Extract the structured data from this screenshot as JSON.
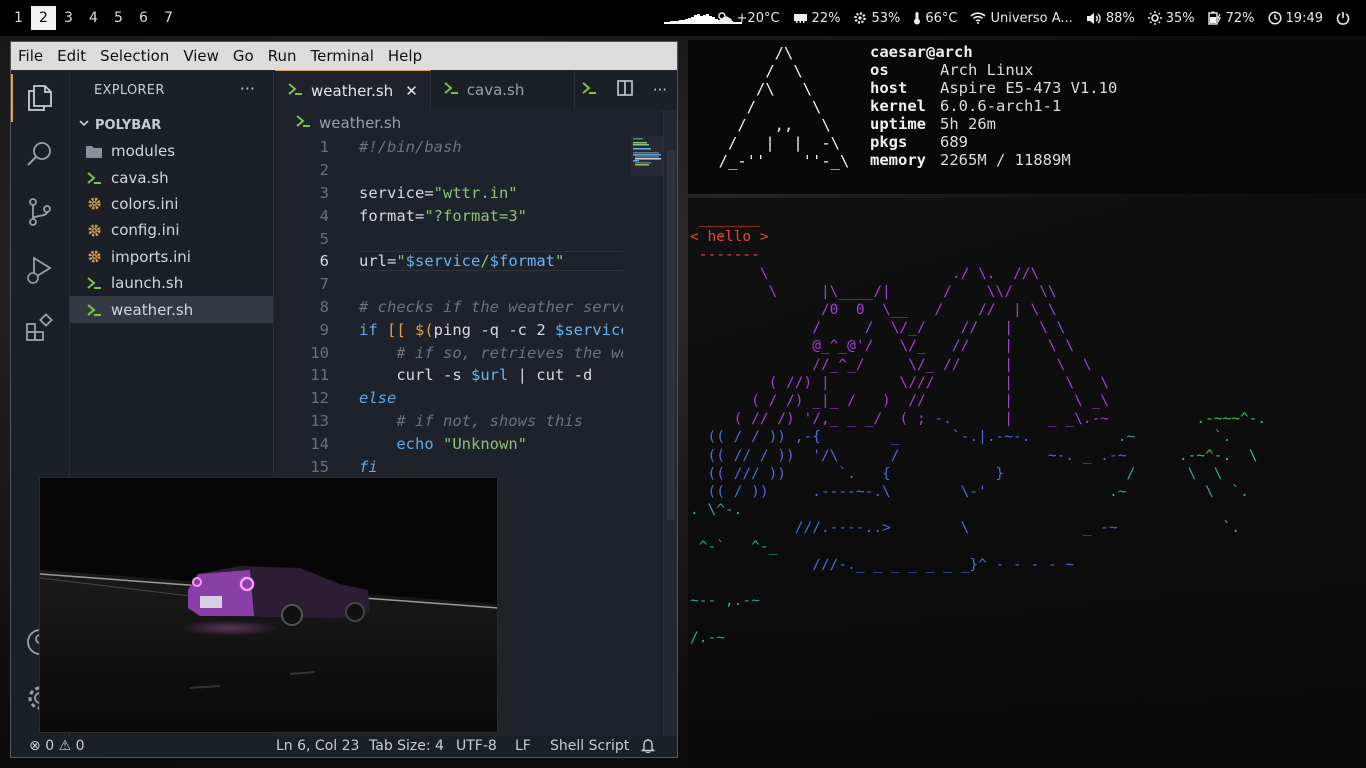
{
  "topbar": {
    "workspaces": [
      "1",
      "2",
      "3",
      "4",
      "5",
      "6",
      "7"
    ],
    "active_workspace": "2",
    "modules": {
      "weather": "+20°C",
      "memory": "22%",
      "cpu": "53%",
      "temperature": "66°C",
      "wifi": "Universo A...",
      "volume": "88%",
      "brightness": "35%",
      "battery": "72%",
      "clock": "19:49"
    }
  },
  "vscode": {
    "menu": [
      "File",
      "Edit",
      "Selection",
      "View",
      "Go",
      "Run",
      "Terminal",
      "Help"
    ],
    "explorer_title": "EXPLORER",
    "explorer_more": "···",
    "folder": "POLYBAR",
    "files": [
      {
        "name": "modules",
        "type": "folder"
      },
      {
        "name": "cava.sh",
        "type": "shell"
      },
      {
        "name": "colors.ini",
        "type": "config"
      },
      {
        "name": "config.ini",
        "type": "config"
      },
      {
        "name": "imports.ini",
        "type": "config"
      },
      {
        "name": "launch.sh",
        "type": "shell"
      },
      {
        "name": "weather.sh",
        "type": "shell",
        "selected": true
      }
    ],
    "tabs": [
      {
        "name": "weather.sh",
        "active": true,
        "close": "✕"
      },
      {
        "name": "cava.sh",
        "active": false
      }
    ],
    "tab_more": "···",
    "breadcrumb": "weather.sh",
    "line_numbers": [
      "1",
      "2",
      "3",
      "4",
      "5",
      "6",
      "7",
      "8",
      "9",
      "10",
      "11",
      "12",
      "13",
      "14",
      "15"
    ],
    "code": {
      "l1": "#!/bin/bash",
      "l3a": "service=",
      "l3b": "\"wttr.in\"",
      "l4a": "format=",
      "l4b": "\"?format=3\"",
      "l6a": "url=",
      "l6b": "\"",
      "l6c": "$service",
      "l6d": "/",
      "l6e": "$format",
      "l6f": "\"",
      "l8": "# checks if the weather server",
      "l9a": "if",
      "l9b": " [[ ",
      "l9c": "$(",
      "l9d": "ping -q -c 2 ",
      "l9e": "$service",
      "l10": "    # if so, retrieves the weather",
      "l11a": "    curl -s ",
      "l11b": "$url",
      "l11c": " | cut -d",
      "l12": "else",
      "l13": "    # if not, shows this",
      "l14a": "    echo ",
      "l14b": "\"Unknown\"",
      "l15": "fi"
    },
    "status": {
      "errors": "0",
      "warnings": "0",
      "position": "Ln 6, Col 23",
      "tab_size": "Tab Size: 4",
      "encoding": "UTF-8",
      "eol": "LF",
      "language": "Shell Script"
    }
  },
  "neofetch": {
    "user_host": "caesar@arch",
    "rows": [
      {
        "key": "os",
        "value": "Arch Linux"
      },
      {
        "key": "host",
        "value": "Aspire E5-473 V1.10"
      },
      {
        "key": "kernel",
        "value": "6.0.6-arch1-1"
      },
      {
        "key": "uptime",
        "value": "5h 26m"
      },
      {
        "key": "pkgs",
        "value": "689"
      },
      {
        "key": "memory",
        "value": "2265M / 11889M"
      }
    ]
  },
  "cowsay": {
    "message": "< hello >"
  },
  "colors": {
    "accent": "#e0a04b",
    "hello_red": "#e8453c",
    "cat_purple": "#a040d0",
    "ascii_blue": "#4a6cd8",
    "ascii_teal": "#2aa8a0",
    "ascii_green": "#40c060"
  }
}
